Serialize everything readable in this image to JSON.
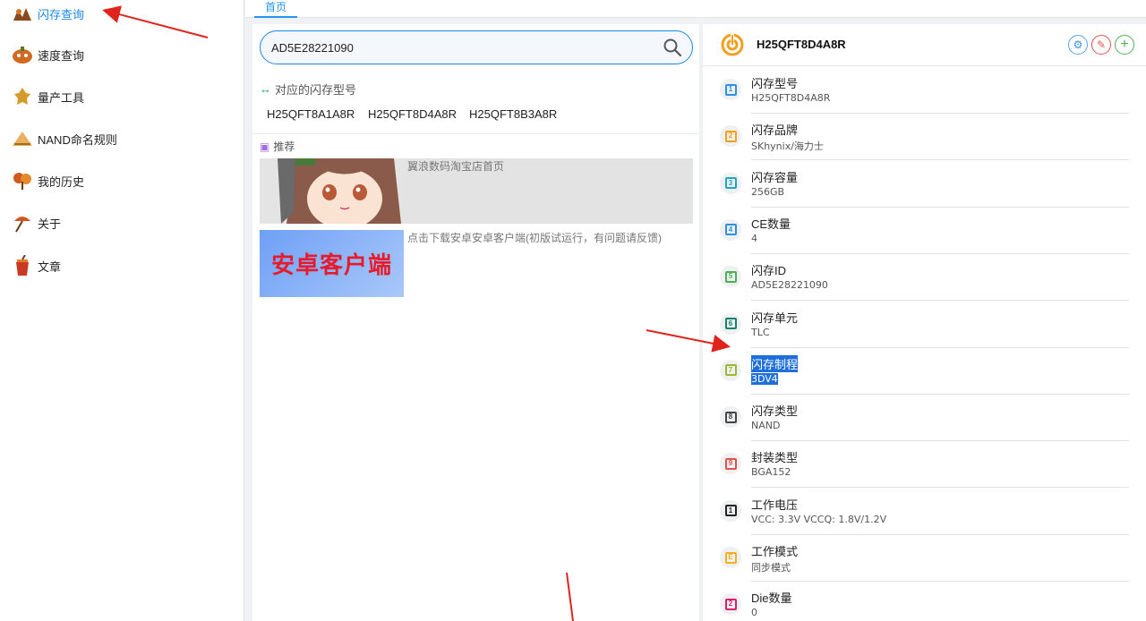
{
  "sidebar": {
    "items": [
      {
        "label": "闪存查询",
        "icon": "flash-query-icon",
        "active": true
      },
      {
        "label": "速度查询",
        "icon": "speed-query-icon"
      },
      {
        "label": "量产工具",
        "icon": "production-tool-icon"
      },
      {
        "label": "NAND命名规则",
        "icon": "naming-rule-icon"
      },
      {
        "label": "我的历史",
        "icon": "history-icon"
      },
      {
        "label": "关于",
        "icon": "about-icon"
      },
      {
        "label": "文章",
        "icon": "article-icon"
      }
    ]
  },
  "tabs": {
    "home": "首页"
  },
  "search": {
    "value": "AD5E28221090",
    "icon": "search-icon"
  },
  "related": {
    "title": "对应的闪存型号",
    "models": [
      "H25QFT8A1A8R",
      "H25QFT8D4A8R",
      "H25QFT8B3A8R"
    ]
  },
  "recommend": {
    "title": "推荐",
    "items": [
      {
        "text": "翼浪数码淘宝店首页"
      },
      {
        "text": "点击下载安卓安卓客户端(初版试运行，有问题请反馈)",
        "thumb_text": "安卓客户端"
      }
    ]
  },
  "detail": {
    "title": "H25QFT8D4A8R",
    "props": [
      {
        "label": "闪存型号",
        "value": "H25QFT8D4A8R",
        "num": "1",
        "color": "#2f8fe0"
      },
      {
        "label": "闪存品牌",
        "value": "SKhynix/海力士",
        "num": "2",
        "color": "#f0a020"
      },
      {
        "label": "闪存容量",
        "value": "256GB",
        "num": "3",
        "color": "#20a7c0"
      },
      {
        "label": "CE数量",
        "value": "4",
        "num": "4",
        "color": "#2f8fe0"
      },
      {
        "label": "闪存ID",
        "value": "AD5E28221090",
        "num": "5",
        "color": "#4caf50"
      },
      {
        "label": "闪存单元",
        "value": "TLC",
        "num": "6",
        "color": "#15806b"
      },
      {
        "label": "闪存制程",
        "value": "3DV4",
        "num": "7",
        "color": "#9cb830",
        "selected": true
      },
      {
        "label": "闪存类型",
        "value": "NAND",
        "num": "8",
        "color": "#444444"
      },
      {
        "label": "封装类型",
        "value": "BGA152",
        "num": "9",
        "color": "#e2524c"
      },
      {
        "label": "工作电压",
        "value": "VCC: 3.3V VCCQ: 1.8V/1.2V",
        "num": "1",
        "color": "#222222"
      },
      {
        "label": "工作模式",
        "value": "同步模式",
        "num": "E",
        "color": "#f0b020"
      },
      {
        "label": "Die数量",
        "value": "0",
        "num": "2",
        "color": "#d8206a"
      }
    ]
  },
  "colors": {
    "accent": "#1e88e5",
    "annotation": "#e0241c"
  }
}
